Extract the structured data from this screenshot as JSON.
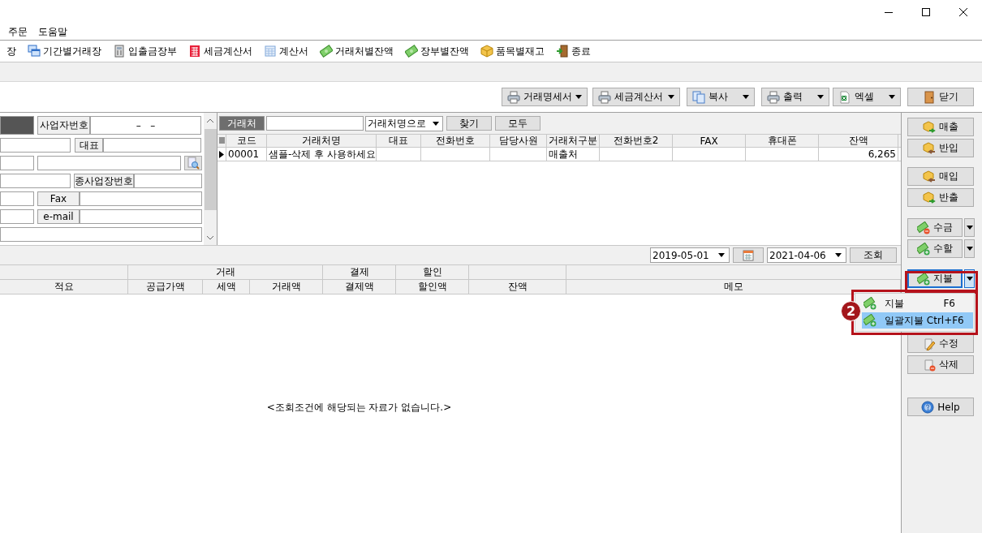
{
  "menu_bar": [
    {
      "label": "주문"
    },
    {
      "label": "도움말"
    }
  ],
  "toolbar": [
    {
      "label": "장"
    },
    {
      "label": "기간별거래장"
    },
    {
      "label": "입출금장부"
    },
    {
      "label": "세금계산서"
    },
    {
      "label": "계산서"
    },
    {
      "label": "거래처별잔액"
    },
    {
      "label": "장부별잔액"
    },
    {
      "label": "품목별재고"
    },
    {
      "label": "종료"
    }
  ],
  "action_buttons": [
    {
      "label": "거래명세서",
      "dropdown": true
    },
    {
      "label": "세금계산서",
      "dropdown": true
    },
    {
      "label": "복사",
      "dropdown": true
    },
    {
      "label": "출력",
      "dropdown": true
    },
    {
      "label": "엑셀",
      "dropdown": true
    },
    {
      "label": "닫기",
      "dropdown": false
    }
  ],
  "company_form": {
    "rows": [
      [
        {
          "kind": "masked"
        },
        {
          "kind": "label",
          "text": "사업자번호"
        },
        {
          "kind": "field",
          "value": "–   –"
        }
      ],
      [
        {
          "kind": "field"
        },
        {
          "kind": "label",
          "text": "대표"
        },
        {
          "kind": "field"
        }
      ],
      [
        {
          "kind": "field"
        },
        {
          "kind": "field"
        },
        {
          "kind": "lookup"
        }
      ],
      [
        {
          "kind": "field"
        },
        {
          "kind": "label",
          "text": "종사업장번호"
        },
        {
          "kind": "field"
        }
      ],
      [
        {
          "kind": "field"
        },
        {
          "kind": "label",
          "text": "Fax"
        },
        {
          "kind": "field"
        }
      ],
      [
        {
          "kind": "field"
        },
        {
          "kind": "label",
          "text": "e-mail"
        },
        {
          "kind": "field"
        }
      ],
      [
        {
          "kind": "field"
        }
      ]
    ]
  },
  "customer_search": {
    "label": "거래처",
    "mode": "거래처명으로",
    "buttons": [
      {
        "label": "찾기"
      },
      {
        "label": "모두"
      }
    ]
  },
  "customer_grid": {
    "columns": [
      "코드",
      "거래처명",
      "대표",
      "전화번호",
      "담당사원",
      "거래처구분",
      "전화번호2",
      "FAX",
      "휴대폰",
      "잔액"
    ],
    "rows": [
      {
        "current": true,
        "cells": [
          "00001",
          "샘플-삭제 후 사용하세요",
          "",
          "",
          "",
          "매출처",
          "",
          "",
          "",
          "6,265"
        ]
      }
    ]
  },
  "date_filter": {
    "from": "2019-05-01",
    "to": "2021-04-06",
    "button": "조회"
  },
  "ledger": {
    "group_headers": [
      "거래",
      "결제",
      "할인"
    ],
    "columns": [
      "적요",
      "공급가액",
      "세액",
      "거래액",
      "결제액",
      "할인액",
      "잔액",
      "메모"
    ],
    "empty_message": "<조회조건에 해당되는 자료가 없습니다.>"
  },
  "side_buttons": [
    [
      {
        "label": "매출",
        "dropdown": false,
        "focused": false
      },
      {
        "label": "반입",
        "dropdown": false,
        "focused": false
      }
    ],
    [
      {
        "label": "매입",
        "dropdown": false,
        "focused": false
      },
      {
        "label": "반출",
        "dropdown": false,
        "focused": false
      }
    ],
    [
      {
        "label": "수금",
        "dropdown": true,
        "focused": false
      },
      {
        "label": "수할",
        "dropdown": true,
        "focused": false
      }
    ],
    [
      {
        "label": "지불",
        "dropdown": true,
        "focused": true
      }
    ],
    [
      {
        "label": "수정",
        "dropdown": false,
        "focused": false
      },
      {
        "label": "삭제",
        "dropdown": false,
        "focused": false
      }
    ],
    [
      {
        "label": "Help",
        "dropdown": false,
        "focused": false
      }
    ]
  ],
  "popup_menu": {
    "items": [
      {
        "label": "지불",
        "shortcut": "F6",
        "selected": false
      },
      {
        "label": "일괄지불 Ctrl+F6",
        "selected": true
      }
    ]
  },
  "annotation": {
    "badge": "2"
  }
}
